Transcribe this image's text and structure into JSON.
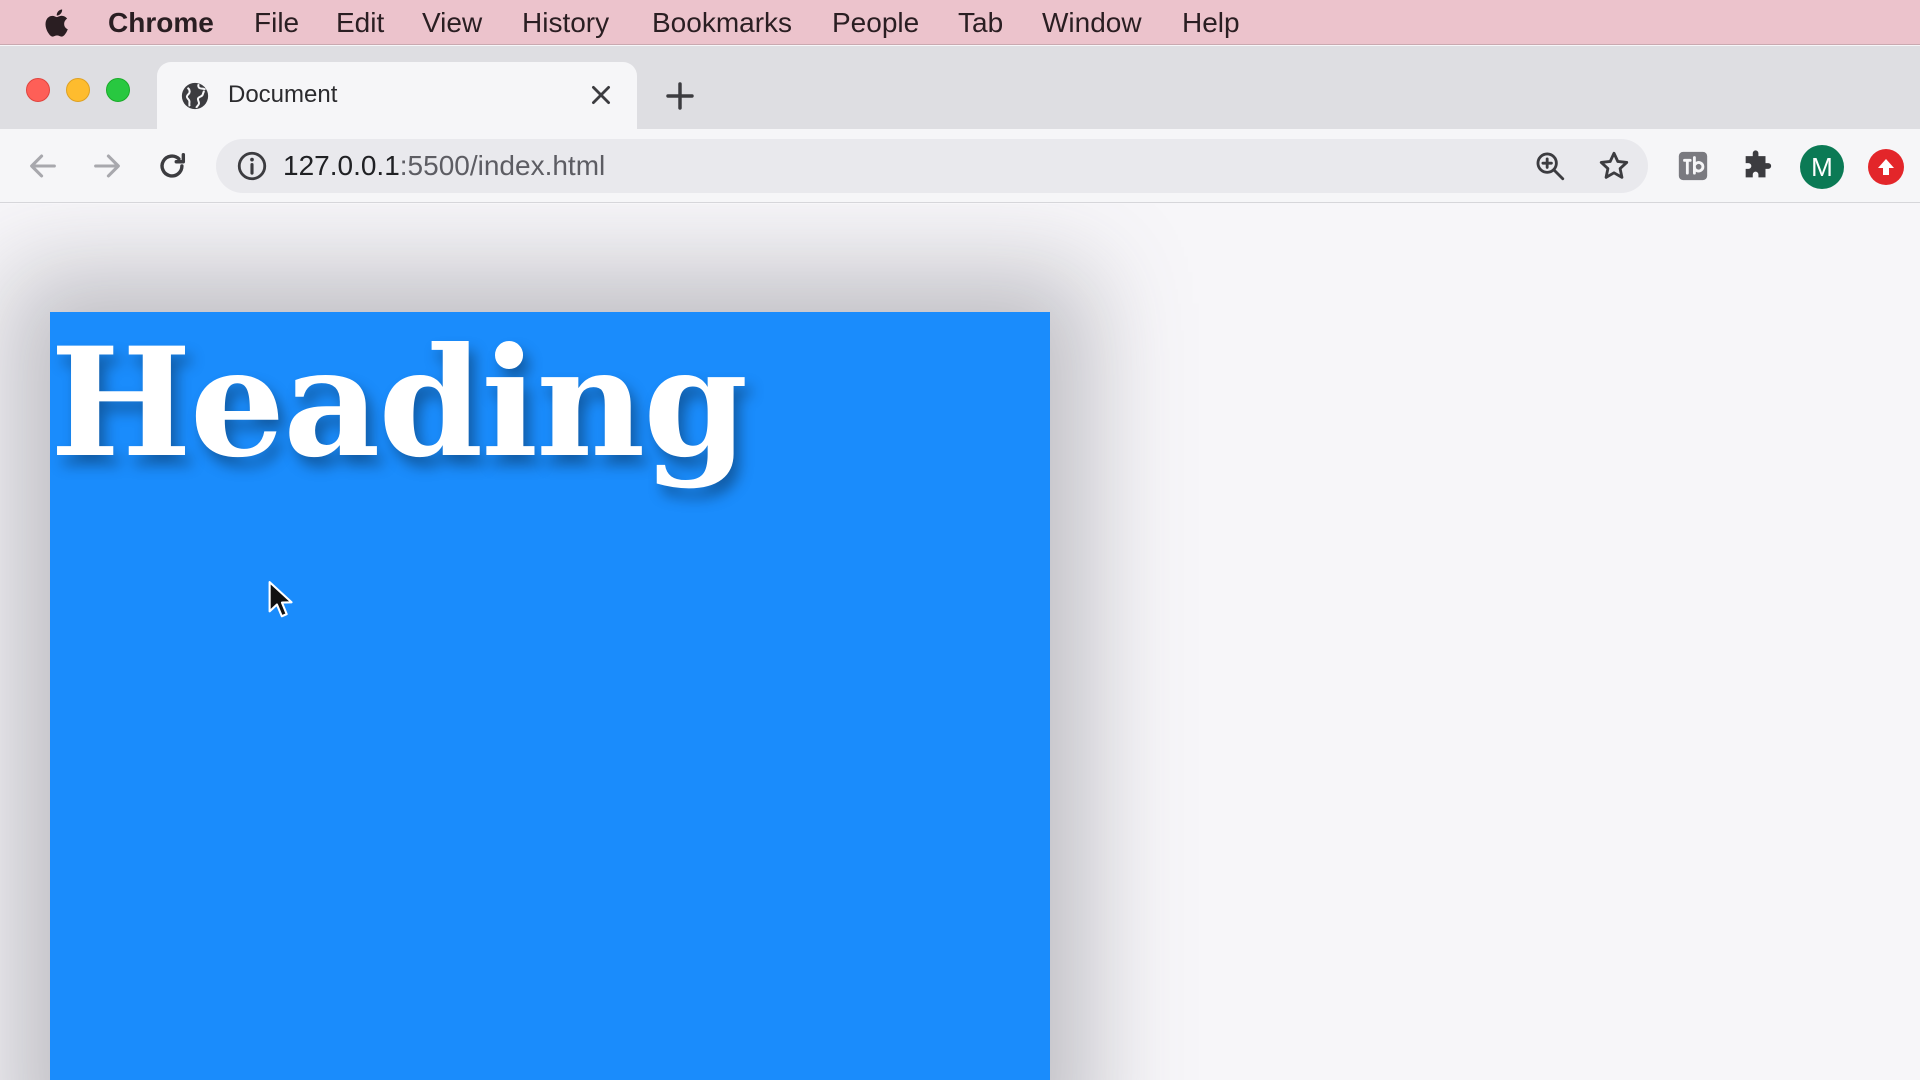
{
  "menubar": {
    "app_name": "Chrome",
    "items": [
      "File",
      "Edit",
      "View",
      "History",
      "Bookmarks",
      "People",
      "Tab",
      "Window",
      "Help"
    ]
  },
  "tab": {
    "title": "Document"
  },
  "omnibox": {
    "host": "127.0.0.1",
    "rest": ":5500/index.html"
  },
  "profile": {
    "initial": "M",
    "color": "#0b7a55"
  },
  "page": {
    "heading": "Heading",
    "box_color": "#1a8cfc"
  },
  "colors": {
    "menubar": "#ecc3cc",
    "close": "#fe5f57",
    "minimize": "#febc2e",
    "maximize": "#28c840"
  }
}
